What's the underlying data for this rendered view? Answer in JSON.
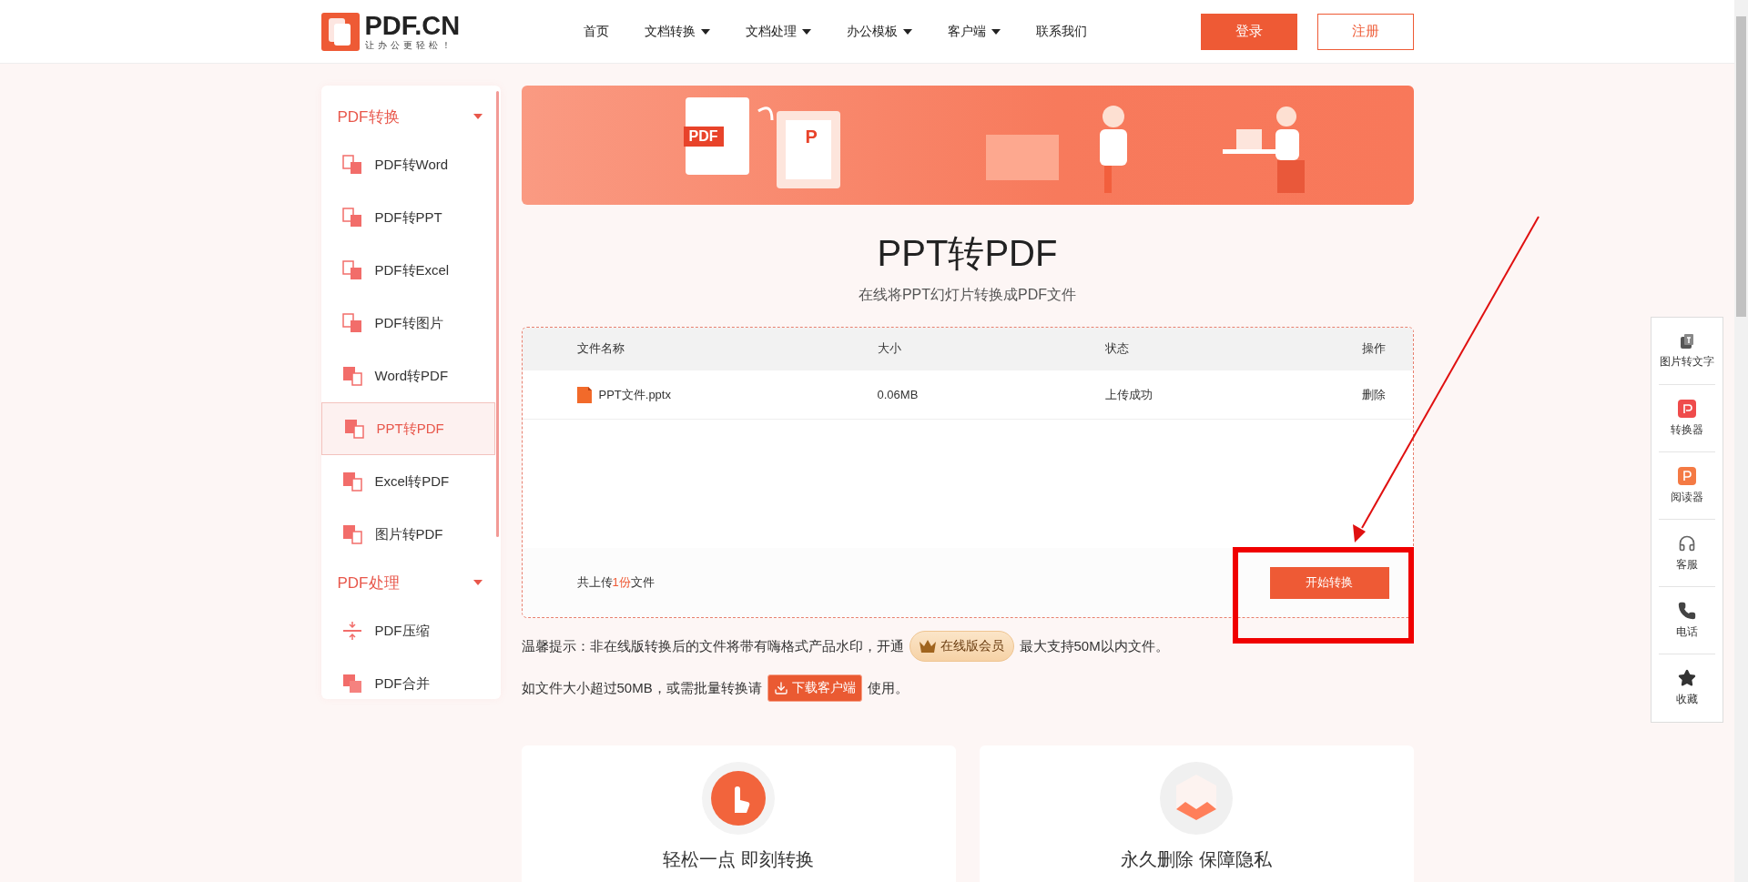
{
  "header": {
    "logo": {
      "name": "PDF.CN",
      "tagline": "让办公更轻松！"
    },
    "nav": [
      {
        "label": "首页",
        "dropdown": false
      },
      {
        "label": "文档转换",
        "dropdown": true
      },
      {
        "label": "文档处理",
        "dropdown": true
      },
      {
        "label": "办公模板",
        "dropdown": true
      },
      {
        "label": "客户端",
        "dropdown": true
      },
      {
        "label": "联系我们",
        "dropdown": false
      }
    ],
    "login": "登录",
    "register": "注册"
  },
  "sidebar": {
    "groups": [
      {
        "title": "PDF转换",
        "expanded": true,
        "items": [
          {
            "label": "PDF转Word",
            "kind": "from-pdf",
            "selected": false
          },
          {
            "label": "PDF转PPT",
            "kind": "from-pdf",
            "selected": false
          },
          {
            "label": "PDF转Excel",
            "kind": "from-pdf",
            "selected": false
          },
          {
            "label": "PDF转图片",
            "kind": "from-pdf",
            "selected": false
          },
          {
            "label": "Word转PDF",
            "kind": "to-pdf",
            "selected": false
          },
          {
            "label": "PPT转PDF",
            "kind": "to-pdf",
            "selected": true
          },
          {
            "label": "Excel转PDF",
            "kind": "to-pdf",
            "selected": false
          },
          {
            "label": "图片转PDF",
            "kind": "to-pdf",
            "selected": false
          }
        ]
      },
      {
        "title": "PDF处理",
        "expanded": true,
        "items": [
          {
            "label": "PDF压缩",
            "kind": "compress",
            "selected": false
          },
          {
            "label": "PDF合并",
            "kind": "merge",
            "selected": false
          }
        ]
      }
    ]
  },
  "banner": {
    "labels": [
      "PDF",
      "P"
    ]
  },
  "title": "PPT转PDF",
  "subtitle": "在线将PPT幻灯片转换成PDF文件",
  "table": {
    "columns": [
      "文件名称",
      "大小",
      "状态",
      "操作"
    ],
    "rows": [
      {
        "name": "PPT文件.pptx",
        "size": "0.06MB",
        "status": "上传成功",
        "action": "删除"
      }
    ],
    "summary": {
      "prefix": "共上传",
      "count": "1份",
      "suffix": "文件"
    },
    "start_button": "开始转换"
  },
  "notices": [
    {
      "text": "温馨提示：非在线版转换后的文件将带有嗨格式产品水印，开通",
      "kind": "vip",
      "badge": "在线版会员",
      "after": "最大支持50M以内文件。"
    },
    {
      "text": "如文件大小超过50MB，或需批量转换请",
      "kind": "download",
      "badge": "下载客户端",
      "after": "使用。"
    }
  ],
  "features": [
    {
      "title": "轻松一点 即刻转换",
      "kind": "click"
    },
    {
      "title": "永久删除 保障隐私",
      "kind": "cube"
    }
  ],
  "float_panel": [
    {
      "label": "图片转文字",
      "kind": "ocr"
    },
    {
      "label": "转换器",
      "kind": "converter"
    },
    {
      "label": "阅读器",
      "kind": "reader"
    },
    {
      "label": "客服",
      "kind": "support"
    },
    {
      "label": "电话",
      "kind": "phone"
    },
    {
      "label": "收藏",
      "kind": "favorite"
    }
  ]
}
